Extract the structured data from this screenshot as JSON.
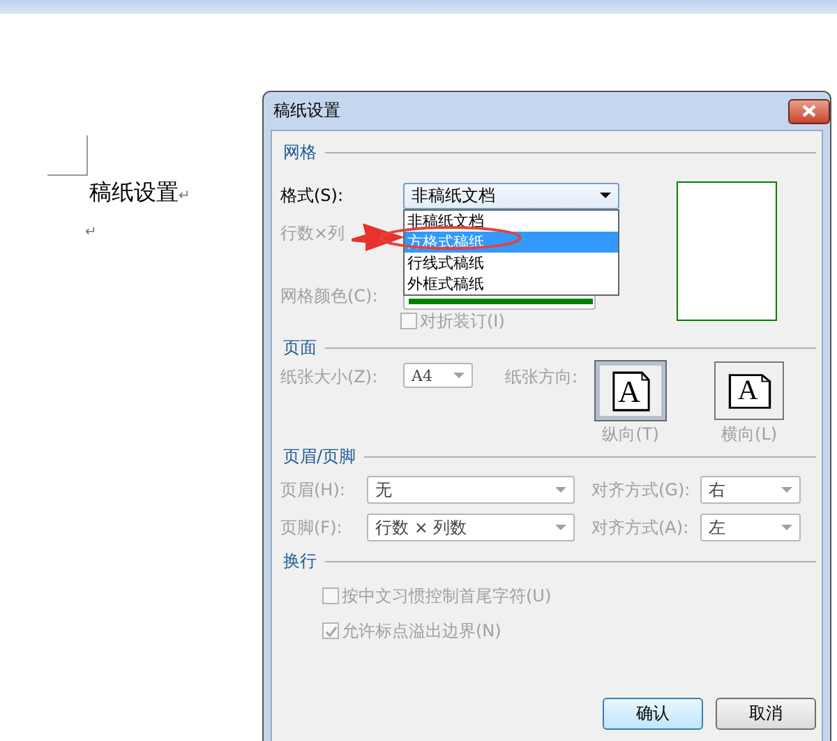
{
  "document": {
    "heading": "稿纸设置",
    "marks": [
      "↵",
      "↵"
    ]
  },
  "dialog": {
    "title": "稿纸设置",
    "grid_section": {
      "heading": "网格",
      "format_label": "格式(S):",
      "format_value": "非稿纸文档",
      "format_options": [
        {
          "label": "非稿纸文档",
          "selected": false
        },
        {
          "label": "方格式稿纸",
          "selected": true
        },
        {
          "label": "行线式稿纸",
          "selected": false
        },
        {
          "label": "外框式稿纸",
          "selected": false
        }
      ],
      "rows_label": "行数×列",
      "color_label": "网格颜色(C):",
      "fold_checkbox": {
        "label": "对折装订(I)",
        "checked": false,
        "disabled": true
      }
    },
    "page_section": {
      "heading": "页面",
      "size_label": "纸张大小(Z):",
      "size_value": "A4",
      "orientation_label": "纸张方向:",
      "orientations": [
        {
          "label": "纵向(T)",
          "glyph": "A",
          "selected": true
        },
        {
          "label": "横向(L)",
          "glyph": "A",
          "selected": false
        }
      ]
    },
    "header_footer_section": {
      "heading": "页眉/页脚",
      "rows": [
        {
          "label": "页眉(H):",
          "value": "无",
          "align_label": "对齐方式(G):",
          "align_value": "右"
        },
        {
          "label": "页脚(F):",
          "value": "行数 × 列数",
          "align_label": "对齐方式(A):",
          "align_value": "左"
        }
      ]
    },
    "line_break_section": {
      "heading": "换行",
      "options": [
        {
          "label": "按中文习惯控制首尾字符(U)",
          "checked": false,
          "disabled": true
        },
        {
          "label": "允许标点溢出边界(N)",
          "checked": true,
          "disabled": true
        }
      ]
    },
    "buttons": [
      {
        "label": "确认",
        "default": true
      },
      {
        "label": "取消",
        "default": false
      }
    ]
  }
}
